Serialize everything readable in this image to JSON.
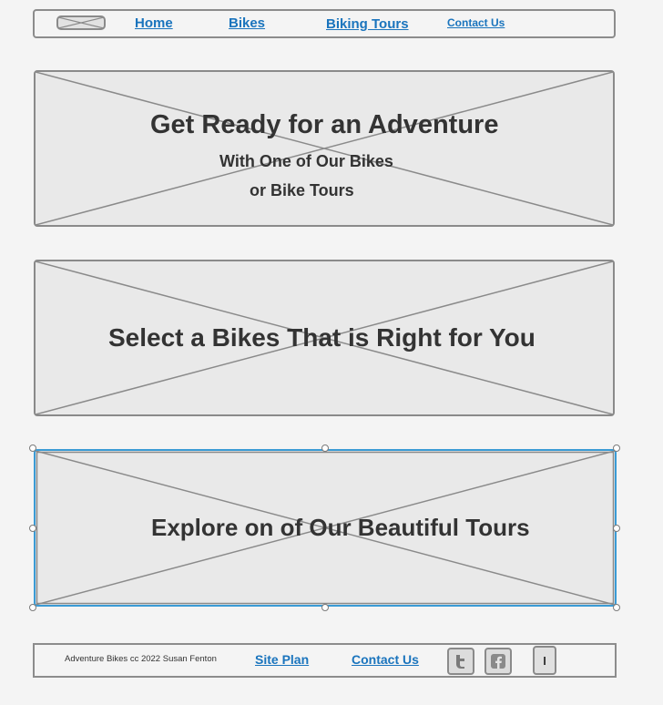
{
  "nav": {
    "items": [
      {
        "label": "Home"
      },
      {
        "label": "Bikes"
      },
      {
        "label": "Biking Tours"
      },
      {
        "label": "Contact Us"
      }
    ]
  },
  "hero": {
    "title": "Get Ready for an Adventure",
    "subtitle_line1": "With One of Our Bikes",
    "subtitle_line2": "or Bike Tours"
  },
  "bikes_section": {
    "title": "Select a Bikes That is Right for You"
  },
  "tours_section": {
    "title": "Explore on of Our Beautiful Tours"
  },
  "footer": {
    "copyright": "Adventure Bikes cc 2022 Susan Fenton",
    "site_plan_label": "Site Plan",
    "contact_label": "Contact Us",
    "instagram_glyph": "I"
  },
  "icons": [
    "logo-placeholder-icon",
    "twitter-icon",
    "facebook-icon",
    "instagram-icon"
  ],
  "colors": {
    "link": "#1a74bd",
    "selection": "#3a9bd5",
    "placeholder_fill": "#e9e9e9",
    "border": "#8a8a8a"
  }
}
